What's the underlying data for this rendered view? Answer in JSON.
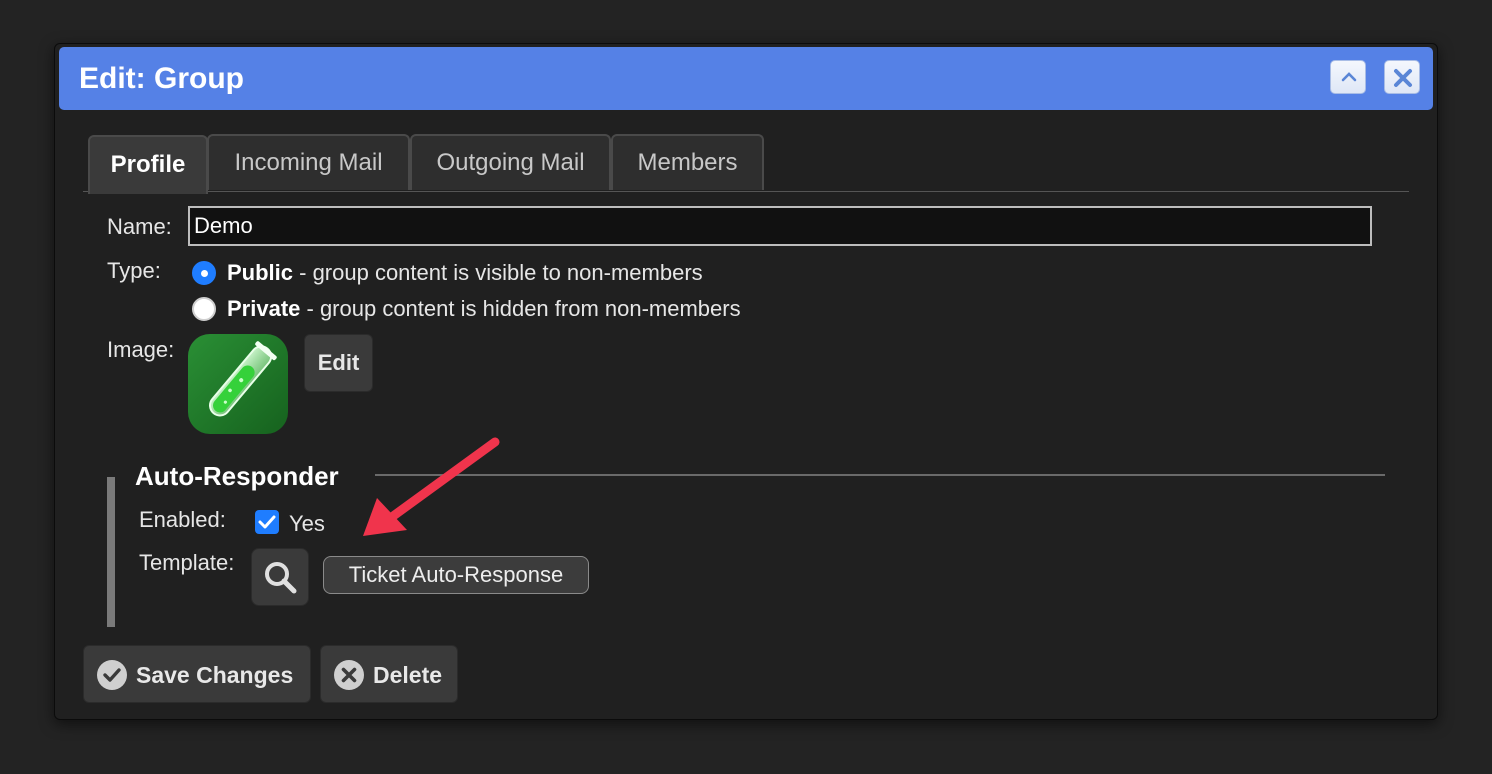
{
  "dialog": {
    "title": "Edit: Group",
    "accent_color": "#5581e6",
    "title_buttons": [
      {
        "icon": "chevron-up-icon"
      },
      {
        "icon": "close-icon"
      }
    ]
  },
  "tabs": [
    {
      "label": "Profile",
      "active": true
    },
    {
      "label": "Incoming Mail",
      "active": false
    },
    {
      "label": "Outgoing Mail",
      "active": false
    },
    {
      "label": "Members",
      "active": false
    }
  ],
  "form": {
    "name_label": "Name:",
    "name_value": "Demo",
    "type_label": "Type:",
    "type_options": [
      {
        "title": "Public",
        "desc": " - group content is visible to non-members",
        "selected": true
      },
      {
        "title": "Private",
        "desc": " - group content is hidden from non-members",
        "selected": false
      }
    ],
    "image_label": "Image:",
    "image_icon": "test-tube-icon",
    "edit_button": "Edit"
  },
  "auto_responder": {
    "legend": "Auto-Responder",
    "enabled_label": "Enabled:",
    "enabled_checked": true,
    "enabled_text": "Yes",
    "template_label": "Template:",
    "template_value": "Ticket Auto-Response",
    "search_icon": "search-icon",
    "annotation_color": "#f0344c"
  },
  "actions": {
    "save_label": "Save Changes",
    "delete_label": "Delete"
  }
}
